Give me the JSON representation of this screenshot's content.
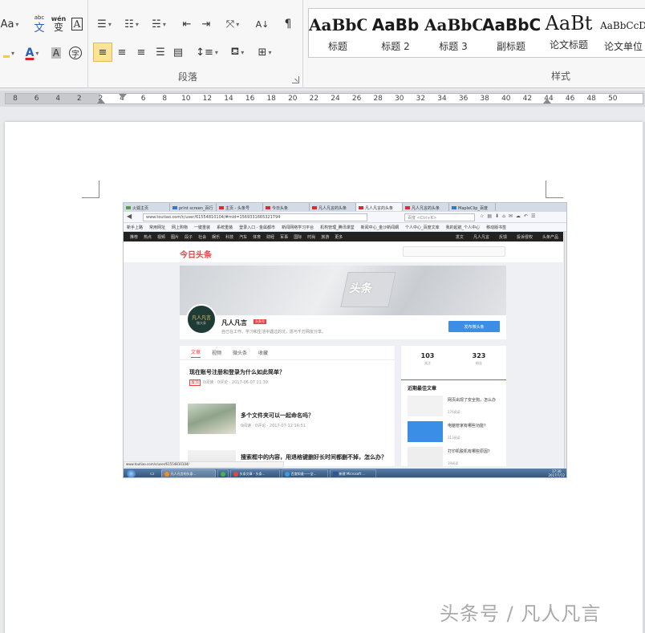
{
  "ribbon": {
    "font_group": {
      "font_size_btn": "Aa",
      "wen_btn": "wén",
      "phonetic_btn": "变",
      "border_char_btn": "A",
      "char_shading_btn": "A",
      "enclose_char_btn": "字"
    },
    "paragraph_group": {
      "label": "段落"
    },
    "styles_group": {
      "label": "样式",
      "items": [
        {
          "sample": "AaBbC",
          "name": "标题"
        },
        {
          "sample": "AaBb",
          "name": "标题 2"
        },
        {
          "sample": "AaBbC",
          "name": "标题 3"
        },
        {
          "sample": "AaBbC",
          "name": "副标题"
        },
        {
          "sample": "AaBt",
          "name": "论文标题"
        },
        {
          "sample": "AaBbCcD",
          "name": "论文单位"
        }
      ]
    },
    "colors": {
      "font_color": "#e02020",
      "highlight": "#f2d31b",
      "active_btn": "#fbe39a"
    }
  },
  "ruler": {
    "ticks": [
      "8",
      "6",
      "4",
      "2",
      "2",
      "4",
      "6",
      "8",
      "10",
      "12",
      "14",
      "16",
      "18",
      "20",
      "22",
      "24",
      "26",
      "28",
      "30",
      "32",
      "34",
      "36",
      "38",
      "40",
      "42",
      "44",
      "46",
      "48",
      "50"
    ]
  },
  "screenshot": {
    "tabs": [
      {
        "label": "火狐主页",
        "active": false
      },
      {
        "label": "print screen_百行",
        "active": false
      },
      {
        "label": "主页 - 头条号",
        "active": false
      },
      {
        "label": "今日头条",
        "active": false
      },
      {
        "label": "凡人凡言的头条",
        "active": false
      },
      {
        "label": "凡人凡言的头条",
        "active": true
      },
      {
        "label": "凡人凡言的头条",
        "active": false
      },
      {
        "label": "MapleClip_百度",
        "active": false
      }
    ],
    "url": "www.toutiao.com/c/user/61554810104/#mid=1569331665321794",
    "search_placeholder": "百度 <Ctrl+K>",
    "bookmarks": [
      "新手上路",
      "常用网址",
      "网上购物",
      "一键重装",
      "系统重装",
      "登录入口 - 金属都市",
      "新闻网络学习平台",
      "机构管理_腾讯课堂",
      "新闻中心_金沙新闻網",
      "个人中心_百度文库",
      "我的起航_个人中心",
      "移动版书签"
    ],
    "nav": [
      "推荐",
      "热点",
      "视频",
      "图片",
      "段子",
      "社会",
      "娱乐",
      "科技",
      "汽车",
      "体育",
      "财经",
      "军事",
      "国际",
      "时尚",
      "旅游",
      "更多"
    ],
    "nav_right": [
      "发文",
      "凡人凡言",
      "反馈",
      "投诉侵权",
      "头条产品"
    ],
    "site_logo": "今日头条",
    "banner_text": "头条",
    "avatar_text": "凡人凡言",
    "avatar_sub": "微头条",
    "profile_name": "凡人凡言",
    "profile_badge": "头条号",
    "profile_desc": "自己在工作、学习和生活中遇过的坑，愿与千万网友分享。",
    "publish_btn": "发布微头条",
    "feed_tabs": [
      "文章",
      "视频",
      "微头条",
      "收藏"
    ],
    "articles": [
      {
        "title": "现在账号注册和登录为什么如此简单？",
        "meta": "0阅读 · 0评论 · 2017-06-07 21:39",
        "tag": "置顶"
      },
      {
        "title": "多个文件夹可以一起命名吗？",
        "meta": "0阅读 · 0评论 · 2017-07-12 16:51"
      },
      {
        "title": "搜索框中的内容，用退格键删好长时间都删不掉，怎么办？",
        "meta": ""
      }
    ],
    "stats": [
      {
        "num": "103",
        "label": "关注"
      },
      {
        "num": "323",
        "label": "粉丝"
      }
    ],
    "sidebar_title": "近期最佳文章",
    "sidebar_items": [
      {
        "title": "网页出现了安全狗，怎么办",
        "meta": "276阅读"
      },
      {
        "title": "电脑管家有哪些功能？",
        "meta": "213阅读"
      },
      {
        "title": "打印机脱机有哪些原因？",
        "meta": "39阅读"
      }
    ],
    "status_url": "www.toutiao.com/c/user/61554810104/",
    "taskbar": [
      "凡人凡言的头条...",
      "",
      "头条文章 - 头条...",
      "百度知道——全...",
      "新建 Microsoft ..."
    ],
    "clock_time": "17:30",
    "clock_date": "2017/7/12"
  },
  "watermark": "头条号 / 凡人凡言"
}
